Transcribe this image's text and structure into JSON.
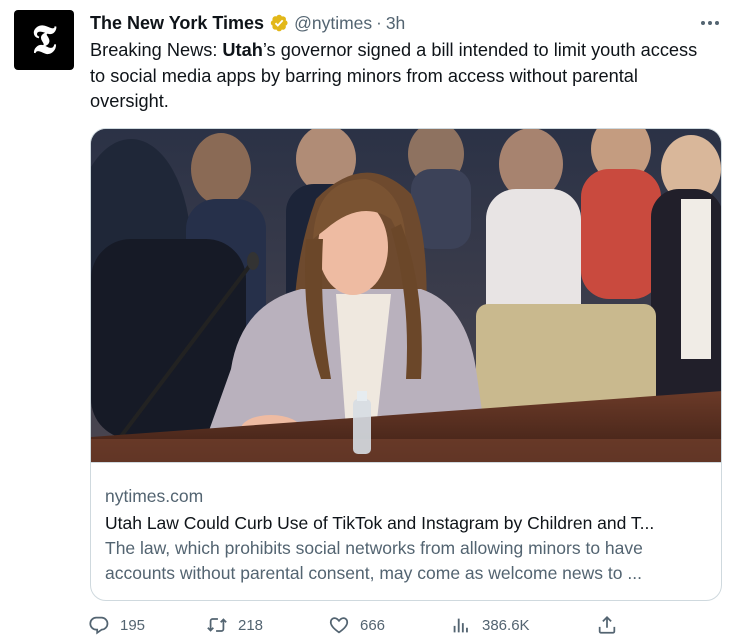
{
  "author": {
    "display_name": "The New York Times",
    "handle": "@nytimes",
    "separator": "·",
    "time": "3h",
    "avatar_glyph": "𝕿"
  },
  "tweet": {
    "prefix": "Breaking News: ",
    "bold": "Utah",
    "suffix": "’s governor signed a bill intended to limit youth access to social media apps by barring minors from access without parental oversight."
  },
  "card": {
    "domain": "nytimes.com",
    "title": "Utah Law Could Curb Use of TikTok and Instagram by Children and T...",
    "description": "The law, which prohibits social networks from allowing minors to have accounts without parental consent, may come as welcome news to ..."
  },
  "actions": {
    "replies": "195",
    "retweets": "218",
    "likes": "666",
    "views": "386.6K"
  },
  "colors": {
    "text": "#0f1419",
    "secondary": "#536471",
    "border": "#cfd9de",
    "verified_gold": "#e2b719"
  },
  "icons": [
    "more-icon",
    "verified-badge-icon",
    "reply-icon",
    "retweet-icon",
    "like-icon",
    "views-icon",
    "share-icon"
  ]
}
